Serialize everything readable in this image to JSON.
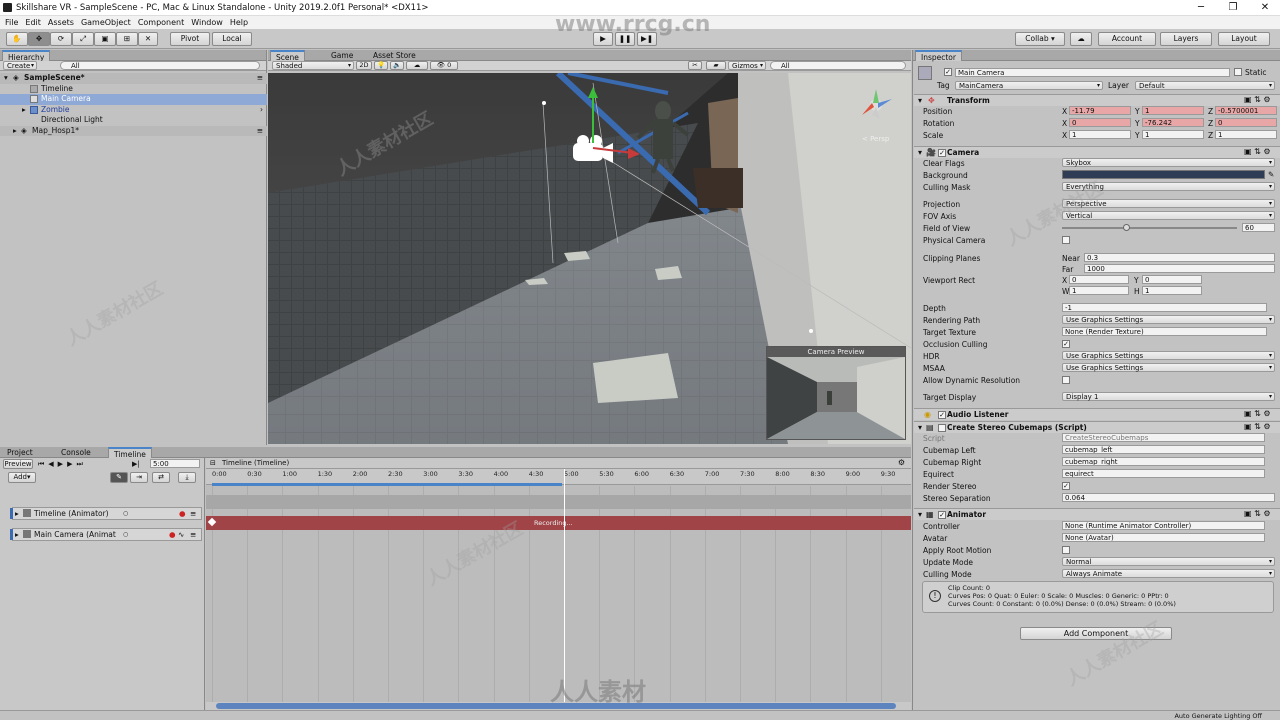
{
  "window": {
    "title": "Skillshare VR - SampleScene - PC, Mac & Linux Standalone - Unity 2019.2.0f1 Personal* <DX11>",
    "min": "─",
    "max": "❐",
    "close": "✕"
  },
  "menu": [
    "File",
    "Edit",
    "Assets",
    "GameObject",
    "Component",
    "Window",
    "Help"
  ],
  "toolbar": {
    "pivot": "Pivot",
    "local": "Local",
    "collab": "Collab ▾",
    "account": "Account",
    "layers": "Layers",
    "layout": "Layout"
  },
  "hierarchy": {
    "tab": "Hierarchy",
    "create": "Create",
    "search_placeholder": "All",
    "items": [
      {
        "label": "SampleScene*",
        "indent": 0
      },
      {
        "label": "Timeline",
        "indent": 1
      },
      {
        "label": "Main Camera",
        "indent": 1
      },
      {
        "label": "Zombie",
        "indent": 1
      },
      {
        "label": "Directional Light",
        "indent": 1
      },
      {
        "label": "Map_Hosp1*",
        "indent": 0
      }
    ]
  },
  "scene": {
    "tabs": [
      "Scene",
      "Game",
      "Asset Store"
    ],
    "shading": "Shaded",
    "mode": "2D",
    "gizmos": "Gizmos",
    "search_placeholder": "All",
    "persp_label": "< Persp",
    "camera_preview": "Camera Preview",
    "fx_count": "0"
  },
  "timeline": {
    "tabs": [
      "Project",
      "Console",
      "Timeline"
    ],
    "preview": "Preview",
    "time_value": "5:00",
    "title": "Timeline (Timeline)",
    "add": "Add▾",
    "ruler": [
      "0:00",
      "0:30",
      "1:00",
      "1:30",
      "2:00",
      "2:30",
      "3:00",
      "3:30",
      "4:00",
      "4:30",
      "5:00",
      "5:30",
      "6:00",
      "6:30",
      "7:00",
      "7:30",
      "8:00",
      "8:30",
      "9:00",
      "9:30"
    ],
    "tracks": [
      {
        "label": "Timeline (Animator)"
      },
      {
        "label": "Main Camera (Animat"
      }
    ],
    "recording": "Recording..."
  },
  "inspector": {
    "tab": "Inspector",
    "name": "Main Camera",
    "static": "Static",
    "tag_label": "Tag",
    "tag": "MainCamera",
    "layer_label": "Layer",
    "layer": "Default",
    "transform": {
      "title": "Transform",
      "position": {
        "label": "Position",
        "x": "-11.79",
        "y": "1",
        "z": "-0.5700001"
      },
      "rotation": {
        "label": "Rotation",
        "x": "0",
        "y": "-76.242",
        "z": "0"
      },
      "scale": {
        "label": "Scale",
        "x": "1",
        "y": "1",
        "z": "1"
      }
    },
    "camera": {
      "title": "Camera",
      "rows": [
        {
          "label": "Clear Flags",
          "value": "Skybox",
          "type": "dd"
        },
        {
          "label": "Background",
          "value": "",
          "type": "color"
        },
        {
          "label": "Culling Mask",
          "value": "Everything",
          "type": "dd"
        },
        {
          "label": "Projection",
          "value": "Perspective",
          "type": "dd"
        },
        {
          "label": "FOV Axis",
          "value": "Vertical",
          "type": "dd"
        },
        {
          "label": "Field of View",
          "value": "60",
          "type": "slider"
        },
        {
          "label": "Physical Camera",
          "value": "",
          "type": "check"
        },
        {
          "label": "Clipping Planes",
          "near_label": "Near",
          "near": "0.3",
          "far_label": "Far",
          "far": "1000"
        },
        {
          "label": "Viewport Rect",
          "x": "0",
          "y": "0",
          "w": "1",
          "h": "1"
        },
        {
          "label": "Depth",
          "value": "-1",
          "type": "field"
        },
        {
          "label": "Rendering Path",
          "value": "Use Graphics Settings",
          "type": "dd"
        },
        {
          "label": "Target Texture",
          "value": "None (Render Texture)",
          "type": "field"
        },
        {
          "label": "Occlusion Culling",
          "value": "✓",
          "type": "check"
        },
        {
          "label": "HDR",
          "value": "Use Graphics Settings",
          "type": "dd"
        },
        {
          "label": "MSAA",
          "value": "Use Graphics Settings",
          "type": "dd"
        },
        {
          "label": "Allow Dynamic Resolution",
          "value": "",
          "type": "check"
        },
        {
          "label": "Target Display",
          "value": "Display 1",
          "type": "dd"
        }
      ],
      "fov_fraction": 0.35
    },
    "audio_listener": {
      "title": "Audio Listener"
    },
    "stereo": {
      "title": "Create Stereo Cubemaps (Script)",
      "script_label": "Script",
      "script": "CreateStereoCubemaps",
      "left_label": "Cubemap Left",
      "left": "cubemap_left",
      "right_label": "Cubemap Right",
      "right": "cubemap_right",
      "equirect_label": "Equirect",
      "equirect": "equirect",
      "render_label": "Render Stereo",
      "render": "✓",
      "sep_label": "Stereo Separation",
      "sep": "0.064"
    },
    "animator": {
      "title": "Animator",
      "controller_label": "Controller",
      "controller": "None (Runtime Animator Controller)",
      "avatar_label": "Avatar",
      "avatar": "None (Avatar)",
      "root_label": "Apply Root Motion",
      "update_label": "Update Mode",
      "update": "Normal",
      "culling_label": "Culling Mode",
      "culling": "Always Animate",
      "info1": "Clip Count: 0",
      "info2": "Curves Pos: 0 Quat: 0 Euler: 0 Scale: 0 Muscles: 0 Generic: 0 PPtr: 0",
      "info3": "Curves Count: 0 Constant: 0 (0.0%) Dense: 0 (0.0%) Stream: 0 (0.0%)"
    },
    "add_component": "Add Component"
  },
  "status": {
    "text": "Auto Generate Lighting Off"
  },
  "watermark": {
    "top": "www.rrcg.cn",
    "bottom": "人人素材",
    "tile": "人人素材社区"
  },
  "colors": {
    "accent": "#4a84c8",
    "background_swatch": "#2e3d55",
    "recording": "#a04448",
    "selection": "#8fa9d6"
  }
}
